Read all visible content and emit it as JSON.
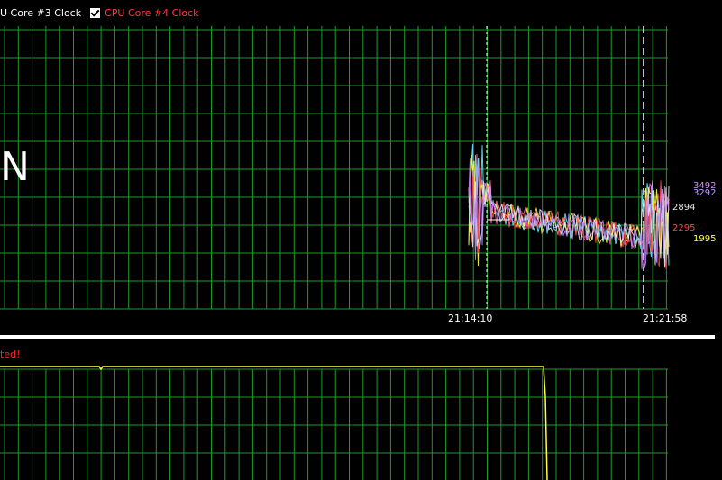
{
  "legend": [
    {
      "label": "U Core #3 Clock",
      "color": "#ffffff",
      "checked": null
    },
    {
      "label": "CPU Core #4 Clock",
      "color": "#ff3b3b",
      "checked": true
    }
  ],
  "top_graph": {
    "big_letter": "N",
    "time_ticks": [
      "21:14:10",
      "21:21:58"
    ],
    "series_values": [
      {
        "value": "3492",
        "color": "#d98cff"
      },
      {
        "value": "3292",
        "color": "#b9a4ff"
      },
      {
        "value": "2894",
        "color": "#e8e8e8"
      },
      {
        "value": "2295",
        "color": "#ff4040"
      },
      {
        "value": "1995",
        "color": "#ffff3c"
      }
    ]
  },
  "bottom_graph": {
    "warning_text": "ted!",
    "warning_color": "#ff2020"
  },
  "colors": {
    "background": "#000000",
    "grid": "#1f9a2a",
    "marker": "#ffffff"
  }
}
